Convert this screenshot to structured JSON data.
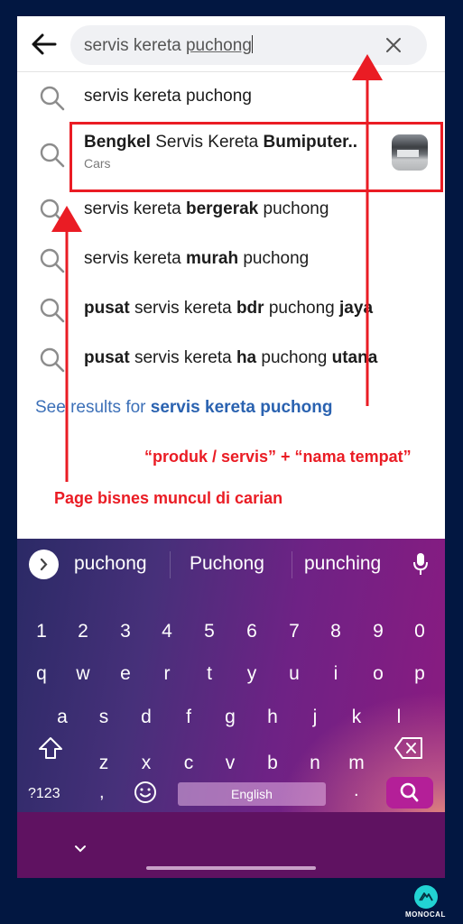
{
  "search": {
    "query_plain": "servis kereta ",
    "query_underlined": "puchong"
  },
  "suggestions": [
    {
      "type": "query",
      "parts": [
        {
          "t": "servis kereta puchong",
          "b": false
        }
      ]
    },
    {
      "type": "page",
      "parts": [
        {
          "t": "Bengkel",
          "b": true
        },
        {
          "t": " Servis Kereta ",
          "b": false
        },
        {
          "t": "Bumiputer..",
          "b": true
        }
      ],
      "category": "Cars"
    },
    {
      "type": "query",
      "parts": [
        {
          "t": "servis kereta ",
          "b": false
        },
        {
          "t": "bergerak",
          "b": true
        },
        {
          "t": " puchong",
          "b": false
        }
      ]
    },
    {
      "type": "query",
      "parts": [
        {
          "t": "servis kereta ",
          "b": false
        },
        {
          "t": "murah",
          "b": true
        },
        {
          "t": " puchong",
          "b": false
        }
      ]
    },
    {
      "type": "query",
      "parts": [
        {
          "t": "pusat",
          "b": true
        },
        {
          "t": " servis kereta ",
          "b": false
        },
        {
          "t": "bdr",
          "b": true
        },
        {
          "t": " puchong ",
          "b": false
        },
        {
          "t": "jaya",
          "b": true
        }
      ]
    },
    {
      "type": "query",
      "parts": [
        {
          "t": "pusat",
          "b": true
        },
        {
          "t": " servis kereta ",
          "b": false
        },
        {
          "t": "ha",
          "b": true
        },
        {
          "t": " puchong ",
          "b": false
        },
        {
          "t": "utana",
          "b": true
        }
      ]
    }
  ],
  "see_results": {
    "prefix": "See results for ",
    "query": "servis kereta puchong"
  },
  "annotations": {
    "keyword_formula": "“produk / servis” + “nama tempat”",
    "page_appears": "Page bisnes muncul di carian"
  },
  "keyboard": {
    "word_suggestions": [
      "puchong",
      "Puchong",
      "punching"
    ],
    "number_row": [
      "1",
      "2",
      "3",
      "4",
      "5",
      "6",
      "7",
      "8",
      "9",
      "0"
    ],
    "row1": [
      "q",
      "w",
      "e",
      "r",
      "t",
      "y",
      "u",
      "i",
      "o",
      "p"
    ],
    "row2": [
      "a",
      "s",
      "d",
      "f",
      "g",
      "h",
      "j",
      "k",
      "l"
    ],
    "row3": [
      "z",
      "x",
      "c",
      "v",
      "b",
      "n",
      "m"
    ],
    "symbols_label": "?123",
    "comma": ",",
    "space_label": "English",
    "period": "."
  },
  "watermark": {
    "brand": "MONOCAL"
  },
  "colors": {
    "annotation": "#ea1c24",
    "link": "#2a62b0",
    "background": "#021741",
    "logo": "#22d3d3"
  }
}
